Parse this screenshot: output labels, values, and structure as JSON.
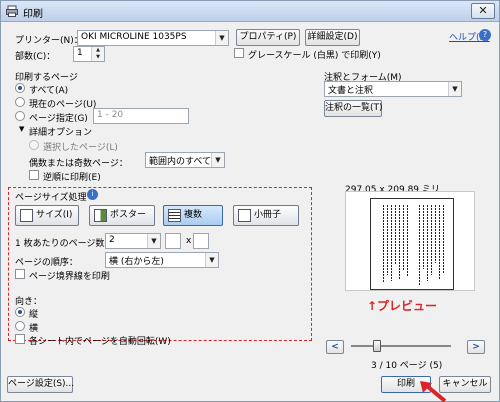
{
  "window": {
    "title": "印刷",
    "close": "✕"
  },
  "top": {
    "printer_label": "プリンター(N)：",
    "printer_value": "OKI MICROLINE 1035PS",
    "properties_button": "プロパティ(P)",
    "advanced_button": "詳細設定(D)",
    "help_link": "ヘルプ(H)",
    "copies_label": "部数(C)：",
    "copies_value": "1",
    "grayscale_label": "グレースケール (白黒) で印刷(Y)"
  },
  "pages": {
    "section_label": "印刷するページ",
    "all": "すべて(A)",
    "current": "現在のページ(U)",
    "specify": "ページ指定(G)",
    "specify_placeholder": "1 - 20",
    "more_options": "詳細オプション",
    "selected": "選択したページ(L)",
    "odd_even_label": "偶数または奇数ページ：",
    "odd_even_value": "範囲内のすべてのページ",
    "reverse": "逆順に印刷(E)"
  },
  "comments": {
    "label": "注釈とフォーム(M)",
    "value": "文書と注釈",
    "summary_button": "注釈の一覧(T)"
  },
  "sizing": {
    "label": "ページサイズ処理",
    "size_button": "サイズ(I)",
    "poster_button": "ポスター",
    "multiple_button": "複数",
    "booklet_button": "小冊子",
    "pages_per_sheet_label": "1 枚あたりのページ数：",
    "pages_per_sheet_value": "2",
    "x_label": "x",
    "order_label": "ページの順序：",
    "order_value": "横 (右から左)",
    "border_label": "ページ境界線を印刷"
  },
  "orientation": {
    "label": "向き：",
    "portrait": "縦",
    "landscape": "横",
    "auto_rotate": "各シート内でページを自動回転(W)"
  },
  "preview": {
    "size_text": "297.05 x 209.89 ミリ",
    "annotation": "↑プレビュー",
    "prev": "<",
    "next": ">",
    "page_counter": "3 / 10 ページ (5)"
  },
  "bottom": {
    "page_setup_button": "ページ設定(S)...",
    "print_button": "印刷",
    "cancel_button": "キャンセル"
  },
  "colors": {
    "accent": "#d9252a",
    "link": "#1a4fb8",
    "selected_tab": "#a9cdf2"
  }
}
